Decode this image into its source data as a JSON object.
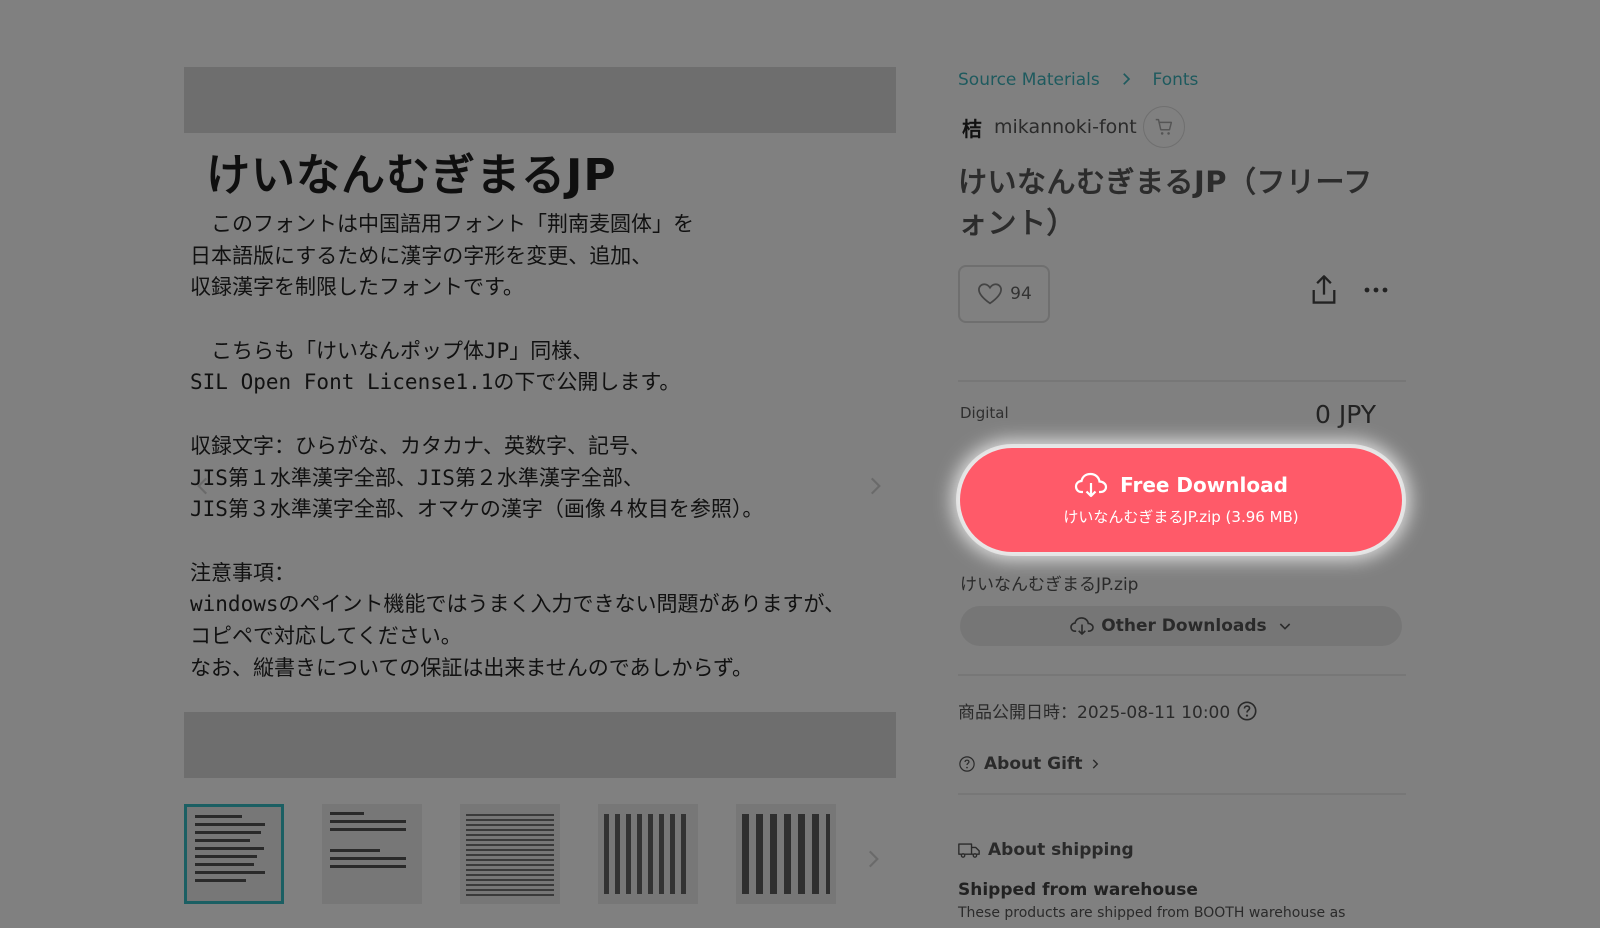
{
  "colors": {
    "overlay": "#808080",
    "accent_teal": "#1e5a5e",
    "download_button": "#ff5a69",
    "active_thumb_border": "#1b5f63"
  },
  "gallery": {
    "slide": {
      "title": "けいなんむぎまるJP",
      "lines": [
        "　このフォントは中国語用フォント「荆南麦圆体」を",
        "日本語版にするために漢字の字形を変更、追加、",
        "収録漢字を制限したフォントです。",
        "",
        "　こちらも「けいなんポップ体JP」同様、",
        "SIL Open Font License1.1の下で公開します。",
        "",
        "収録文字：ひらがな、カタカナ、英数字、記号、",
        "JIS第１水準漢字全部、JIS第２水準漢字全部、",
        "JIS第３水準漢字全部、オマケの漢字（画像４枚目を参照）。",
        "",
        "注意事項：",
        "windowsのペイント機能ではうまく入力できない問題がありますが、",
        "コピペで対応してください。",
        "なお、縦書きについての保証は出来ませんのであしからず。"
      ]
    },
    "prev_icon": "chevron-left-icon",
    "next_icon": "chevron-right-icon",
    "thumbnails": [
      {
        "index": 1,
        "active": true
      },
      {
        "index": 2,
        "active": false
      },
      {
        "index": 3,
        "active": false
      },
      {
        "index": 4,
        "active": false
      },
      {
        "index": 5,
        "active": false
      }
    ]
  },
  "breadcrumb": {
    "items": [
      "Source Materials",
      "Fonts"
    ]
  },
  "shop": {
    "logo": "桔",
    "name": "mikannoki-font",
    "cart_icon": "cart-icon"
  },
  "product": {
    "title": "けいなんむぎまるJP（フリーフォント）",
    "likes": "94",
    "variant": "Digital",
    "price": "0 JPY",
    "download": {
      "label": "Free Download",
      "file": "けいなんむぎまるJP.zip (3.96 MB)"
    },
    "file_name": "けいなんむぎまるJP.zip",
    "other_downloads": "Other Downloads",
    "release": "商品公開日時：2025-08-11 10:00",
    "about_gift": "About Gift",
    "about_shipping": "About shipping",
    "shipped_from": "Shipped from warehouse",
    "shipping_desc": "These products are shipped from BOOTH warehouse as"
  }
}
